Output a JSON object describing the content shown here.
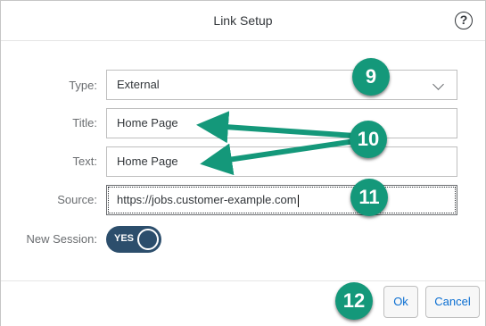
{
  "dialog": {
    "title": "Link Setup",
    "help_icon": "question-circle-icon",
    "help_glyph": "?"
  },
  "form": {
    "type_label": "Type:",
    "type_value": "External",
    "title_label": "Title:",
    "title_value": "Home Page",
    "text_label": "Text:",
    "text_value": "Home Page",
    "source_label": "Source:",
    "source_value": "https://jobs.customer-example.com",
    "new_session_label": "New Session:",
    "new_session_toggle": "YES",
    "new_session_on": true
  },
  "footer": {
    "ok_label": "Ok",
    "cancel_label": "Cancel"
  },
  "annotations": {
    "markers": [
      "9",
      "10",
      "11",
      "12"
    ],
    "color": "#14987a"
  },
  "colors": {
    "accent": "#0a6ed1",
    "toggle_bg": "#2c4e6c",
    "marker": "#14987a"
  }
}
